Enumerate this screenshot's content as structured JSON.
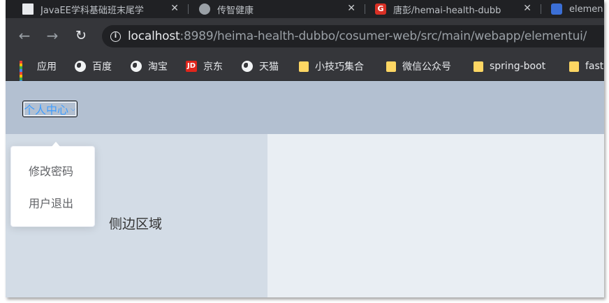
{
  "browser": {
    "tabs": [
      {
        "title": "JavaEE学科基础班末尾学",
        "icon": "page-icon",
        "close": "✕"
      },
      {
        "title": "传智健康",
        "icon": "globe-icon",
        "close": "✕"
      },
      {
        "title": "唐彭/hemai-health-dubb",
        "icon": "gitee-icon",
        "close": "✕"
      },
      {
        "title": "elemen",
        "icon": "baidu-paw-icon"
      }
    ],
    "nav": {
      "back": "←",
      "forward": "→",
      "reload": "↻",
      "info": "i"
    },
    "url": {
      "host": "localhost",
      "rest": ":8989/heima-health-dubbo/cosumer-web/src/main/webapp/elementui/"
    },
    "bookmarks": [
      {
        "label": "应用",
        "icon": "apps-grid-icon"
      },
      {
        "label": "百度",
        "icon": "globe-icon"
      },
      {
        "label": "淘宝",
        "icon": "globe-icon"
      },
      {
        "label": "京东",
        "icon": "jd-icon",
        "badge": "JD"
      },
      {
        "label": "天猫",
        "icon": "globe-icon"
      },
      {
        "label": "小技巧集合",
        "icon": "folder-icon"
      },
      {
        "label": "微信公众号",
        "icon": "folder-icon"
      },
      {
        "label": "spring-boot",
        "icon": "folder-icon"
      },
      {
        "label": "fast",
        "icon": "folder-icon"
      }
    ]
  },
  "page": {
    "header": {
      "dropdown_label": "个人中心",
      "chevron": "⌵"
    },
    "dropdown_menu": {
      "items": [
        "修改密码",
        "用户退出"
      ]
    },
    "aside": {
      "text": "侧边区域"
    }
  },
  "colors": {
    "header_bg": "#b3c0d1",
    "aside_bg": "#d3dce6",
    "main_bg": "#e9eef3",
    "link_blue": "#409eff"
  }
}
